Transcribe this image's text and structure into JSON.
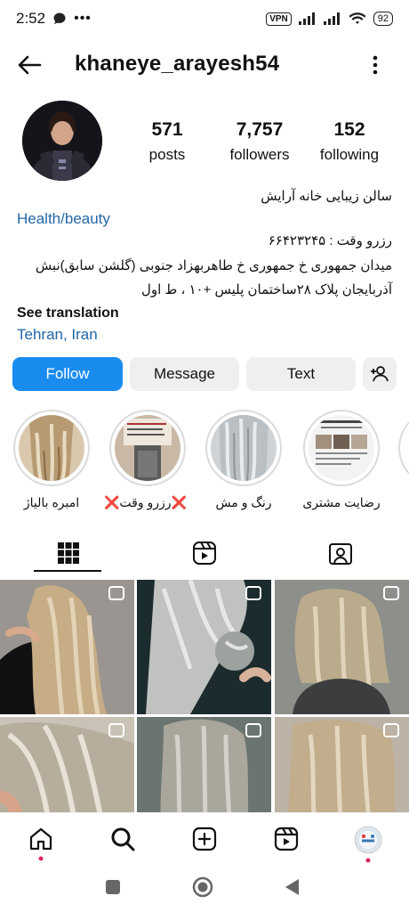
{
  "status": {
    "time": "2:52",
    "vpn": "VPN",
    "battery": "92"
  },
  "header": {
    "username": "khaneye_arayesh54"
  },
  "stats": {
    "posts_num": "571",
    "posts_label": "posts",
    "followers_num": "7,757",
    "followers_label": "followers",
    "following_num": "152",
    "following_label": "following"
  },
  "bio": {
    "name": "سالن زیبایی خانه آرایش",
    "category": "Health/beauty",
    "booking": "رزرو وقت : ۶۶۴۲۳۲۴۵",
    "address_line1": "میدان جمهوری خ جمهوری خ طاهربهزاد جنوبی (گلشن سابق)نبش",
    "address_line2": "آذربایجان پلاک ۲۸ساختمان پلیس +۱۰ ، ط اول",
    "see_translation": "See translation",
    "location": "Tehran, Iran"
  },
  "actions": {
    "follow": "Follow",
    "message": "Message",
    "text": "Text"
  },
  "highlights": [
    {
      "label": "امبره بالیاژ"
    },
    {
      "label": "❌رزرو وقت❌"
    },
    {
      "label": "رنگ و مش"
    },
    {
      "label": "رضایت مشتری"
    }
  ],
  "colors": {
    "accent": "#1a8cf0",
    "link": "#2167a8",
    "button_gray": "#efefef",
    "notification": "#e0245e"
  },
  "icons": {
    "back": "arrow-left-icon",
    "more": "more-vertical-icon",
    "add_user": "add-person-icon",
    "grid": "grid-icon",
    "reels": "reels-icon",
    "tagged": "tagged-person-icon",
    "home": "home-icon",
    "search": "search-icon",
    "create": "plus-square-icon",
    "reels_nav": "reels-icon",
    "profile": "profile-avatar-icon"
  }
}
